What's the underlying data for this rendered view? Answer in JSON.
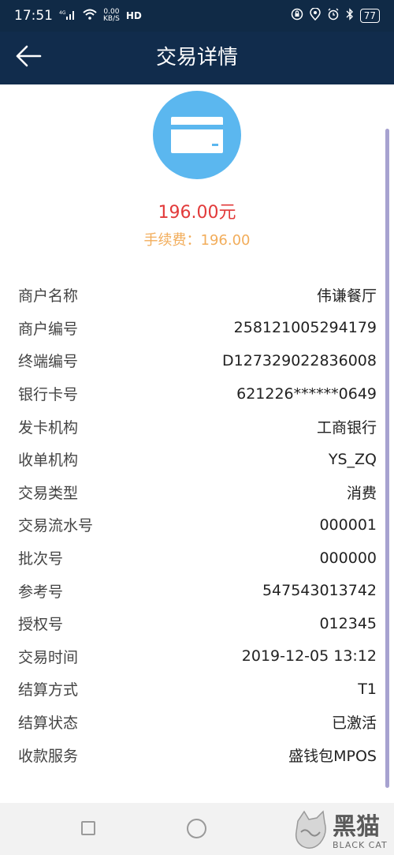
{
  "status_bar": {
    "time": "17:51",
    "signal_label": "4G",
    "net_speed_value": "0.00",
    "net_speed_unit": "KB/S",
    "hd_label": "HD",
    "battery_level": "77"
  },
  "app_bar": {
    "title": "交易详情"
  },
  "summary": {
    "amount": "196.00元",
    "fee": "手续费：196.00",
    "amount_color": "#e23a3a",
    "fee_color": "#f2ad5b",
    "icon_bg_color": "#5bb7ef"
  },
  "details": [
    {
      "label": "商户名称",
      "value": "伟谦餐厅"
    },
    {
      "label": "商户编号",
      "value": "258121005294179"
    },
    {
      "label": "终端编号",
      "value": "D127329022836008"
    },
    {
      "label": "银行卡号",
      "value": "621226******0649"
    },
    {
      "label": "发卡机构",
      "value": "工商银行"
    },
    {
      "label": "收单机构",
      "value": "YS_ZQ"
    },
    {
      "label": "交易类型",
      "value": "消费"
    },
    {
      "label": "交易流水号",
      "value": "000001"
    },
    {
      "label": "批次号",
      "value": "000000"
    },
    {
      "label": "参考号",
      "value": "547543013742"
    },
    {
      "label": "授权号",
      "value": "012345"
    },
    {
      "label": "交易时间",
      "value": "2019-12-05 13:12"
    },
    {
      "label": "结算方式",
      "value": "T1"
    },
    {
      "label": "结算状态",
      "value": "已激活"
    },
    {
      "label": "收款服务",
      "value": "盛钱包MPOS"
    }
  ],
  "watermark": {
    "cn": "黑猫",
    "en": "BLACK CAT"
  }
}
